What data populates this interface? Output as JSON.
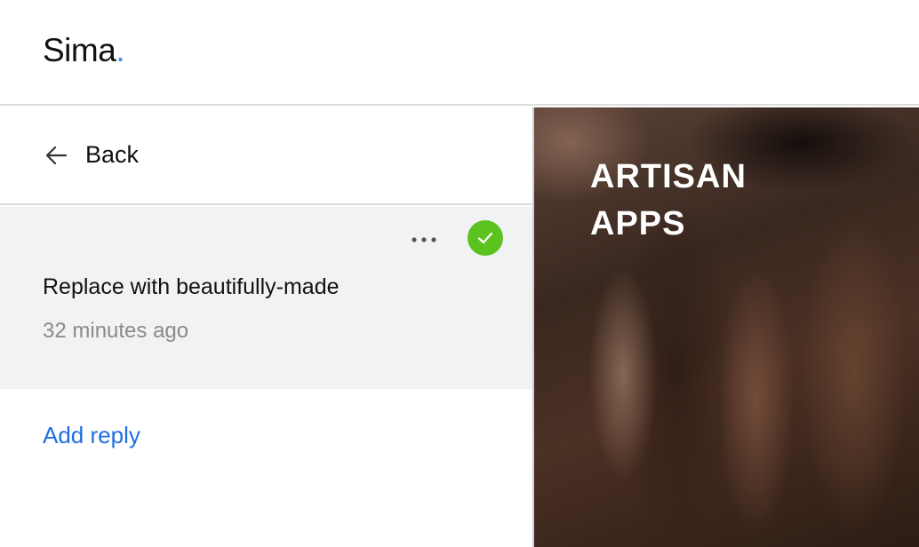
{
  "header": {
    "logo_text": "Sima",
    "logo_dot": "."
  },
  "nav": {
    "back_label": "Back"
  },
  "comment": {
    "text": "Replace with beautifully-made",
    "time": "32 minutes ago",
    "resolved": true
  },
  "reply": {
    "label": "Add reply"
  },
  "hero": {
    "title": "ARTISAN\nAPPS"
  },
  "colors": {
    "accent_dot": "#3f8ef5",
    "check": "#5cc21f",
    "link": "#1f6fe0"
  }
}
